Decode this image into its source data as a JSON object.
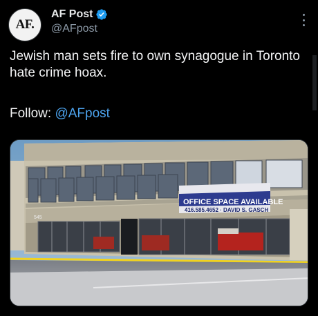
{
  "tweet": {
    "avatar_text": "AF.",
    "display_name": "AF Post",
    "handle": "@AFpost",
    "body": "Jewish man sets fire to own synagogue in Toronto hate crime hoax.",
    "follow_label": "Follow:",
    "follow_handle": "@AFpost"
  },
  "media": {
    "sign_top": "OFFICE SPACE AVAILABLE",
    "sign_bottom": "416.585.4652 · DAVID S. GASCH",
    "building_number": "545"
  },
  "colors": {
    "background": "#000000",
    "link": "#4ca3ee",
    "verified": "#1d9bf0",
    "secondary_text": "#8b98a5"
  },
  "icons": {
    "verified": "verified-badge-icon",
    "more": "more-options-icon"
  }
}
